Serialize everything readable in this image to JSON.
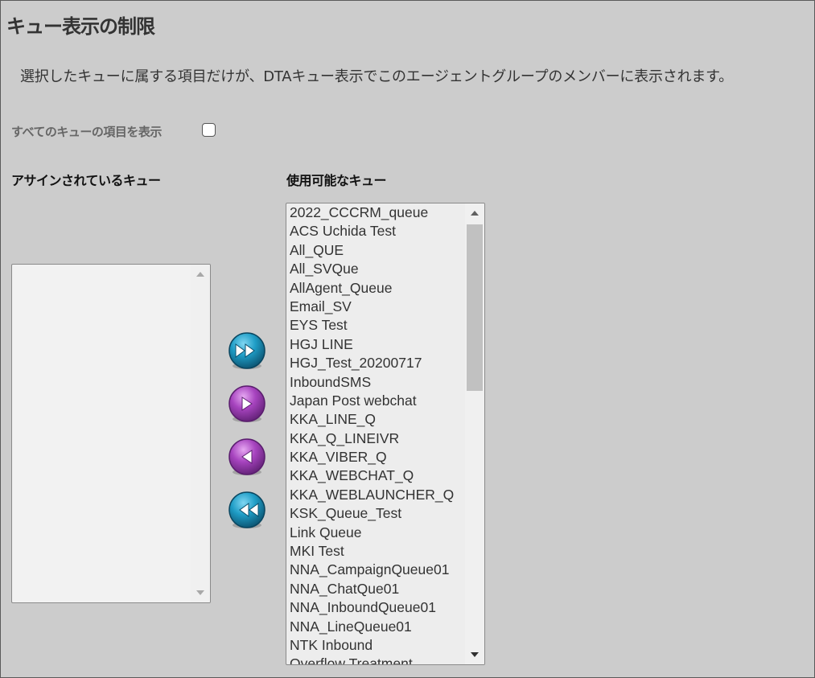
{
  "page": {
    "title": "キュー表示の制限",
    "description": "選択したキューに属する項目だけが、DTAキュー表示でこのエージェントグループのメンバーに表示されます。"
  },
  "show_all": {
    "label": "すべてのキューの項目を表示",
    "checked": false
  },
  "assigned": {
    "heading": "アサインされているキュー",
    "items": []
  },
  "available": {
    "heading": "使用可能なキュー",
    "items": [
      "2022_CCCRM_queue",
      "ACS Uchida Test",
      "All_QUE",
      "All_SVQue",
      "AllAgent_Queue",
      "Email_SV",
      "EYS Test",
      "HGJ LINE",
      "HGJ_Test_20200717",
      "InboundSMS",
      "Japan Post webchat",
      "KKA_LINE_Q",
      "KKA_Q_LINEIVR",
      "KKA_VIBER_Q",
      "KKA_WEBCHAT_Q",
      "KKA_WEBLAUNCHER_Q",
      "KSK_Queue_Test",
      "Link Queue",
      "MKI Test",
      "NNA_CampaignQueue01",
      "NNA_ChatQue01",
      "NNA_InboundQueue01",
      "NNA_LineQueue01",
      "NTK Inbound",
      "Overflow Treatment"
    ]
  },
  "buttons": {
    "add_all": "fast-forward-icon",
    "add": "play-right-icon",
    "remove": "play-left-icon",
    "remove_all": "rewind-icon"
  },
  "colors": {
    "background": "#cccccc",
    "blue_button": "#1f8fb5",
    "purple_button": "#a040b8"
  }
}
